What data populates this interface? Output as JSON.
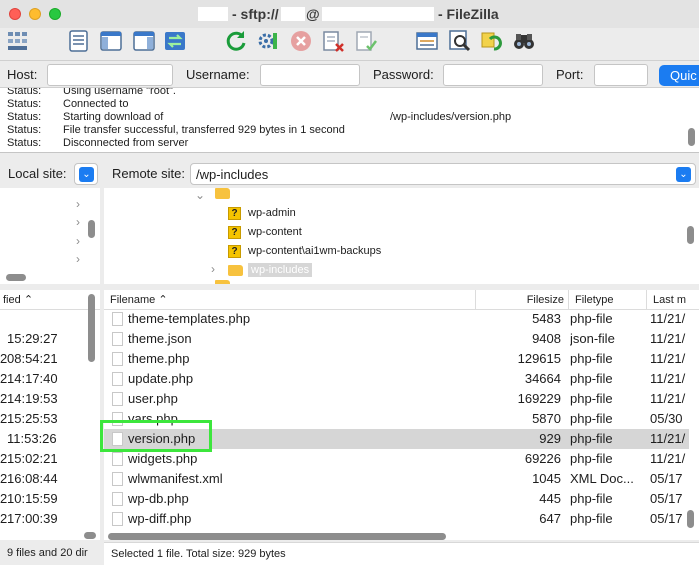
{
  "title": {
    "sep1": "- sftp://",
    "at": "@",
    "app": "- FileZilla"
  },
  "toolbar": {
    "icons": [
      "site-manager-icon",
      "message-log-icon",
      "local-tree-icon",
      "remote-tree-icon",
      "transfer-queue-icon",
      "refresh-icon",
      "process-queue-icon",
      "cancel-icon",
      "disconnect-icon",
      "reconnect-icon",
      "directory-listing-filters-icon",
      "compare-directories-icon",
      "synchronized-browsing-icon",
      "search-remote-files-icon"
    ]
  },
  "quickconnect": {
    "host_label": "Host:",
    "username_label": "Username:",
    "password_label": "Password:",
    "port_label": "Port:",
    "button": "Quic"
  },
  "log": [
    {
      "label": "Status:",
      "text": "Using username \"root\"."
    },
    {
      "label": "Status:",
      "text": "Connected to"
    },
    {
      "label": "Status:",
      "text": "Starting download of",
      "extra": "/wp-includes/version.php"
    },
    {
      "label": "Status:",
      "text": "File transfer successful, transferred 929 bytes in 1 second"
    },
    {
      "label": "Status:",
      "text": "Disconnected from server"
    }
  ],
  "local": {
    "site_label": "Local site:",
    "header": "fied",
    "times": [
      "15:29:27",
      "08:54:21",
      "14:17:40",
      "14:19:53",
      "15:25:53",
      "11:53:26",
      "15:02:21",
      "16:08:44",
      "10:15:59",
      "17:00:39"
    ],
    "prefixes": [
      "",
      "2",
      "2",
      "2",
      "2",
      "",
      "2",
      "2",
      "2",
      "2"
    ],
    "status": "9 files and 20 dir"
  },
  "remote": {
    "site_label": "Remote site:",
    "path": "/wp-includes",
    "tree": [
      {
        "name": "wp-admin",
        "icon": "unknown"
      },
      {
        "name": "wp-content",
        "icon": "unknown"
      },
      {
        "name": "wp-content\\ai1wm-backups",
        "icon": "unknown"
      },
      {
        "name": "wp-includes",
        "icon": "folder"
      }
    ],
    "columns": {
      "filename": "Filename",
      "filesize": "Filesize",
      "filetype": "Filetype",
      "lastmod": "Last m"
    },
    "files": [
      {
        "name": "theme-templates.php",
        "size": "5483",
        "type": "php-file",
        "date": "11/21/"
      },
      {
        "name": "theme.json",
        "size": "9408",
        "type": "json-file",
        "date": "11/21/"
      },
      {
        "name": "theme.php",
        "size": "129615",
        "type": "php-file",
        "date": "11/21/"
      },
      {
        "name": "update.php",
        "size": "34664",
        "type": "php-file",
        "date": "11/21/"
      },
      {
        "name": "user.php",
        "size": "169229",
        "type": "php-file",
        "date": "11/21/"
      },
      {
        "name": "vars.php",
        "size": "5870",
        "type": "php-file",
        "date": "05/30"
      },
      {
        "name": "version.php",
        "size": "929",
        "type": "php-file",
        "date": "11/21/"
      },
      {
        "name": "widgets.php",
        "size": "69226",
        "type": "php-file",
        "date": "11/21/"
      },
      {
        "name": "wlwmanifest.xml",
        "size": "1045",
        "type": "XML Doc...",
        "date": "05/17"
      },
      {
        "name": "wp-db.php",
        "size": "445",
        "type": "php-file",
        "date": "05/17"
      },
      {
        "name": "wp-diff.php",
        "size": "647",
        "type": "php-file",
        "date": "05/17"
      }
    ],
    "status": "Selected 1 file. Total size: 929 bytes"
  }
}
